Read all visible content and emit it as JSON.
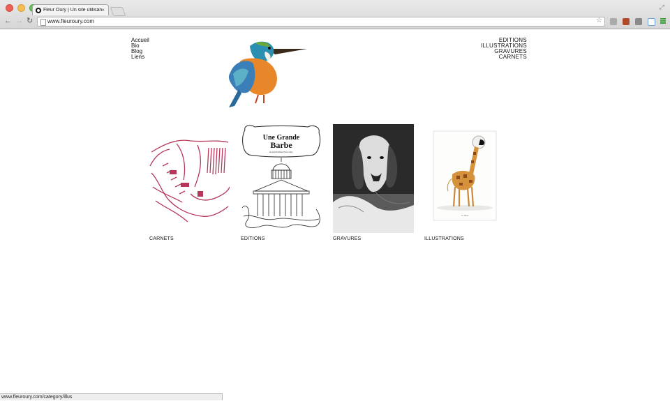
{
  "browser": {
    "tab_title": "Fleur Oury | Un site utilisant",
    "tab_close": "×",
    "url": "www.fleuroury.com",
    "status_url": "www.fleuroury.com/category/illus"
  },
  "nav_left": [
    "Accueil",
    "Bio",
    "Blog",
    "Liens"
  ],
  "nav_right": [
    "EDITIONS",
    "ILLUSTRATIONS",
    "GRAVURES",
    "CARNETS"
  ],
  "gallery": [
    {
      "caption": "CARNETS",
      "icon": "red-sketch-thumbnail"
    },
    {
      "caption": "EDITIONS",
      "icon": "book-cover-thumbnail",
      "cover_title_1": "Une Grande",
      "cover_title_2": "Barbe",
      "cover_authors": "Roland Fréhllud   Fleur Oury"
    },
    {
      "caption": "GRAVURES",
      "icon": "engraving-dog-thumbnail"
    },
    {
      "caption": "ILLUSTRATIONS",
      "icon": "giraffe-illustration-thumbnail",
      "plate_caption": "Le Haub"
    }
  ],
  "colors": {
    "sketch_red": "#b5375a",
    "engraving_bg": "#2a2a2a"
  }
}
